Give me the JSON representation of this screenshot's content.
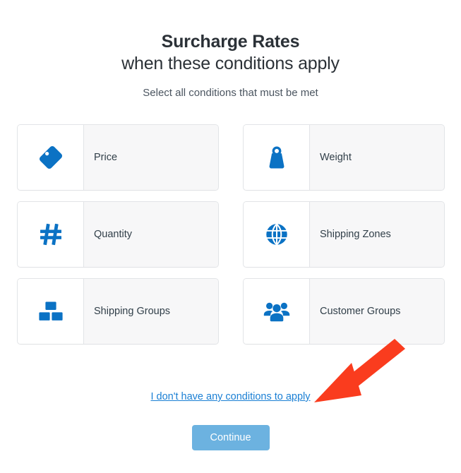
{
  "header": {
    "title_line_1": "Surcharge Rates",
    "title_line_2": "when these conditions apply",
    "subtitle": "Select all conditions that must be met"
  },
  "options": [
    {
      "label": "Price",
      "icon": "tag-icon"
    },
    {
      "label": "Weight",
      "icon": "weight-icon"
    },
    {
      "label": "Quantity",
      "icon": "hash-icon"
    },
    {
      "label": "Shipping Zones",
      "icon": "globe-icon"
    },
    {
      "label": "Shipping Groups",
      "icon": "boxes-icon"
    },
    {
      "label": "Customer Groups",
      "icon": "people-group-icon"
    }
  ],
  "footer": {
    "skip_link": "I don't have any conditions to apply",
    "continue_label": "Continue"
  },
  "annotation": {
    "arrow": "red-arrow-pointing-to-skip-link"
  },
  "colors": {
    "icon_blue": "#0b72c4",
    "link_blue": "#1a7fd4",
    "button_blue": "#6cb2e0",
    "arrow_red": "#fa3c1e",
    "card_bg": "#f7f7f8",
    "card_border": "#e2e4e7",
    "text_dark": "#2b3137"
  }
}
